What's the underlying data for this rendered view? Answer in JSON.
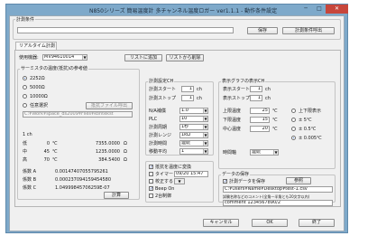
{
  "window": {
    "title": "N850シリーズ 簡易温度計 多チャンネル温度ロガー ver1.1.1 - 動作条件設定",
    "min": "─",
    "max": "□",
    "close": "✕"
  },
  "condition": {
    "group_label": "計測条件",
    "name_value": "",
    "save_btn": "保存",
    "read_btn": "計測条件呼出"
  },
  "tab": {
    "label": "リアルタイム計測"
  },
  "device": {
    "label": "使用機器:",
    "selected": "MV94610014",
    "add_btn": "リストに追加",
    "remove_btn": "リストから削除"
  },
  "thermistor": {
    "group_label": "サーミスタの温度(抵抗)の参考値",
    "options": [
      "2252Ω",
      "5000Ω",
      "10000Ω",
      "任意選択"
    ],
    "selected_index": 0,
    "file_btn": "抵抗ファイル呼出",
    "file_path": "C:¥Work¥space_ds2009¥Files¥kontekst",
    "ch_label": "1 ch",
    "temp_rows": [
      {
        "name": "低",
        "temp": "0",
        "unit": "℃",
        "res": "7355.0000",
        "ohm": "Ω"
      },
      {
        "name": "中",
        "temp": "45",
        "unit": "℃",
        "res": "1235.0000",
        "ohm": "Ω"
      },
      {
        "name": "高",
        "temp": "70",
        "unit": "℃",
        "res": "384.5400",
        "ohm": "Ω"
      }
    ],
    "coef_rows": [
      {
        "name": "係数 A",
        "value": "0.00147407055795261"
      },
      {
        "name": "係数 B",
        "value": "0.000237094159454580"
      },
      {
        "name": "係数 C",
        "value": "1.04999845706259E-07"
      }
    ],
    "calc_btn": "計算"
  },
  "measure": {
    "group_label": "計測設定CH",
    "start_label": "計測スタート",
    "start_value": "1",
    "start_unit": "ch",
    "stop_label": "計測ストップ",
    "stop_value": "1",
    "stop_unit": "ch",
    "rows": [
      {
        "label": "N/A補償",
        "value": "1.0"
      },
      {
        "label": "PLC",
        "value": "10"
      },
      {
        "label": "計測周期",
        "value": "1秒"
      },
      {
        "label": "計測レンジ",
        "value": "1kΩ"
      },
      {
        "label": "計測時間",
        "value": "連続"
      },
      {
        "label": "移動平均",
        "value": "1"
      }
    ],
    "opt_title": "",
    "opts": [
      {
        "label": "抵抗を温度に変換",
        "checked": true
      },
      {
        "label": "タイマー",
        "checked": false,
        "value": "09/20 15:47"
      },
      {
        "label": "校正する",
        "checked": false
      },
      {
        "label": "Beep On",
        "checked": true
      },
      {
        "label": "2台制御",
        "checked": false
      }
    ]
  },
  "display": {
    "group_label": "表示グラフの表示CH",
    "start_label": "表示スタート",
    "start_value": "1",
    "start_unit": "ch",
    "stop_label": "表示ストップ",
    "stop_value": "1",
    "stop_unit": "ch",
    "limit_rows": [
      {
        "label": "上限温度",
        "value": "25",
        "unit": "℃"
      },
      {
        "label": "下限温度",
        "value": "15",
        "unit": "℃"
      },
      {
        "label": "中心温度",
        "value": "20",
        "unit": "℃"
      }
    ],
    "span_opts": [
      "上下限表示",
      "± 5℃",
      "± 0.5℃",
      "± 0.005℃"
    ],
    "span_selected": 3,
    "time_label": "時間軸",
    "time_value": "連続"
  },
  "save": {
    "group_label": "データの保存",
    "check_label": "計測データを保存",
    "check_checked": true,
    "ref_btn": "参照",
    "path_value": "C:¥Users¥Name¥Desktop¥test-1.csv",
    "comment_label": "試験名称などのコメント(全角一半角とも20文字以内)",
    "comment_value": "comment 1234567890/2"
  },
  "footer": {
    "cancel": "キャンセル",
    "ok": "OK",
    "close": "終了"
  }
}
